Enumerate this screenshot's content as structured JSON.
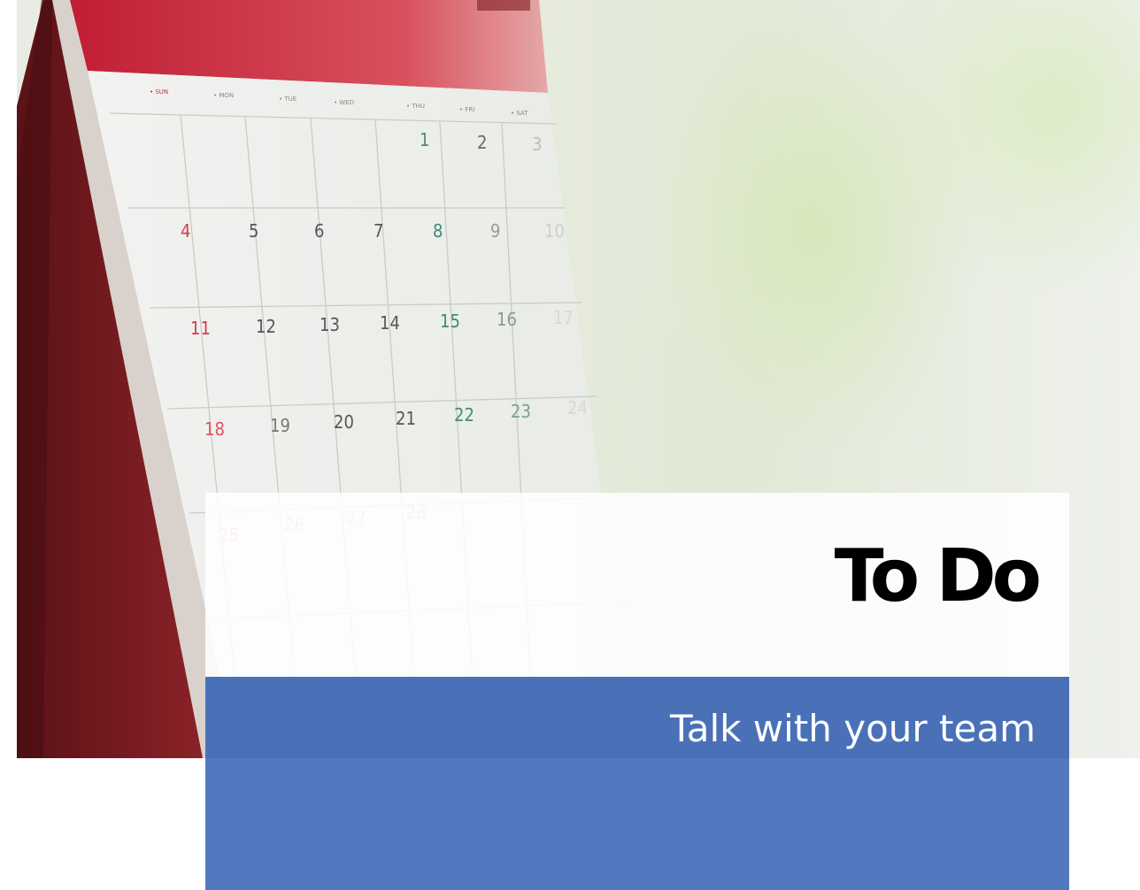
{
  "slide": {
    "title": "To Do",
    "subtitle": "Talk with your team"
  },
  "background_photo": {
    "subject": "desk calendar",
    "calendar": {
      "weekday_labels": [
        "SUN",
        "MON",
        "TUE",
        "WED",
        "THU",
        "FRI",
        "SAT"
      ],
      "rows": [
        [
          "",
          "",
          "",
          "",
          "1",
          "2",
          "3"
        ],
        [
          "4",
          "5",
          "6",
          "7",
          "8",
          "9",
          "10"
        ],
        [
          "11",
          "12",
          "13",
          "14",
          "15",
          "16",
          "17"
        ],
        [
          "18",
          "19",
          "20",
          "21",
          "22",
          "23",
          "24"
        ],
        [
          "25",
          "26",
          "27",
          "28",
          "",
          "",
          ""
        ]
      ]
    }
  },
  "colors": {
    "title_panel": "#ffffff",
    "subtitle_panel": "#5278c0",
    "calendar_header": "#c8283a",
    "calendar_stand": "#7a1c20",
    "sunday_numbers": "#d23c4c",
    "thursday_numbers": "#3f8a78",
    "weekday_numbers": "#555555"
  }
}
